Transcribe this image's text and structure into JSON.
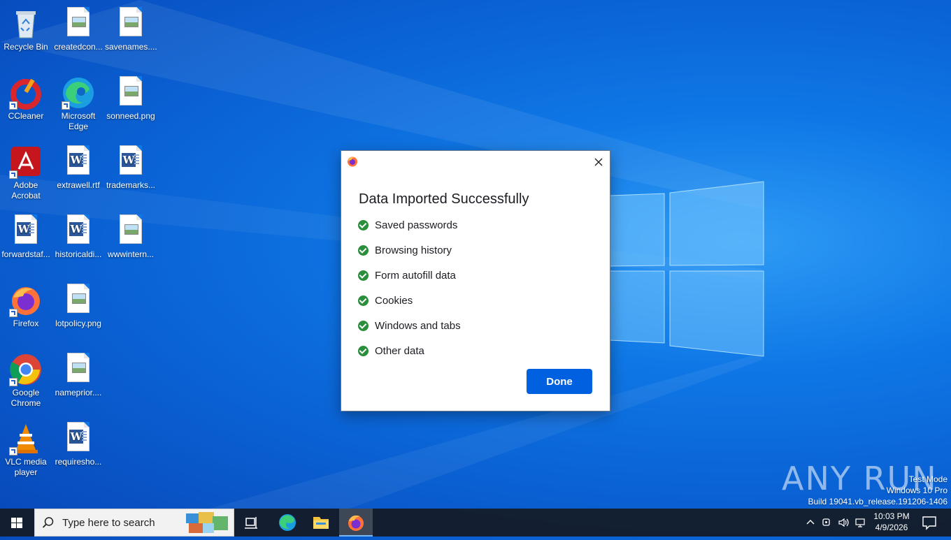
{
  "desktop": {
    "icons": [
      {
        "label": "Recycle Bin"
      },
      {
        "label": "createdcon..."
      },
      {
        "label": "savenames...."
      },
      {
        "label": "CCleaner"
      },
      {
        "label": "Microsoft Edge"
      },
      {
        "label": "sonneed.png"
      },
      {
        "label": "Adobe Acrobat"
      },
      {
        "label": "extrawell.rtf"
      },
      {
        "label": "trademarks..."
      },
      {
        "label": "forwardstaf..."
      },
      {
        "label": "historicaldi..."
      },
      {
        "label": "wwwintern..."
      },
      {
        "label": "Firefox"
      },
      {
        "label": "lotpolicy.png"
      },
      {
        "label": "Google Chrome"
      },
      {
        "label": "nameprior...."
      },
      {
        "label": "VLC media player"
      },
      {
        "label": "requiresho..."
      }
    ]
  },
  "dialog": {
    "title": "Data Imported Successfully",
    "items": [
      "Saved passwords",
      "Browsing history",
      "Form autofill data",
      "Cookies",
      "Windows and tabs",
      "Other data"
    ],
    "done_label": "Done",
    "accent_color": "#0061e0",
    "check_color": "#2a8e3a"
  },
  "watermark": {
    "brand": "ANY RUN",
    "test_mode": "Test Mode",
    "os": "Windows 10 Pro",
    "build": "Build 19041.vb_release.191206-1406"
  },
  "taskbar": {
    "search_placeholder": "Type here to search",
    "time": "10:03 PM",
    "date": "4/9/2026"
  }
}
